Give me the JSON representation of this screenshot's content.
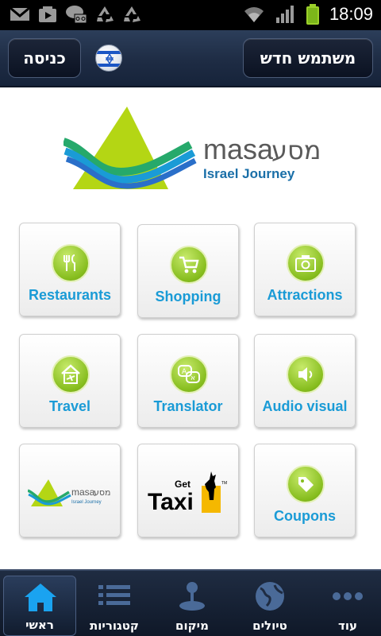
{
  "status_bar": {
    "time": "18:09",
    "left_icons": [
      "gmail-icon",
      "media-icon",
      "voicemail-icon",
      "recycle-icon",
      "recycle-icon"
    ],
    "right_icons": [
      "wifi-icon",
      "signal-icon",
      "battery-icon"
    ]
  },
  "header": {
    "login_label": "כניסה",
    "new_user_label": "משתמש חדש",
    "flag_icon": "israel-flag-icon"
  },
  "logo": {
    "brand": "masa",
    "brand_hebrew": "מסע",
    "tagline": "Israel Journey"
  },
  "grid": {
    "restaurants": "Restaurants",
    "shopping": "Shopping",
    "attractions": "Attractions",
    "travel": "Travel",
    "translator": "Translator",
    "audio_visual": "Audio visual",
    "coupons": "Coupons",
    "masa_mini": {
      "brand": "masa",
      "brand_hebrew": "מסע",
      "tagline": "Israel Journey"
    },
    "taxi": {
      "get": "Get",
      "taxi": "Taxi",
      "tm": "TM"
    }
  },
  "bottom_nav": {
    "home": "ראשי",
    "categories": "קטגוריות",
    "location": "מיקום",
    "tours": "טיולים",
    "more": "עוד"
  },
  "colors": {
    "accent_green": "#86bd1e",
    "label_blue": "#1a9bd6",
    "header_navy": "#1e2c44"
  }
}
